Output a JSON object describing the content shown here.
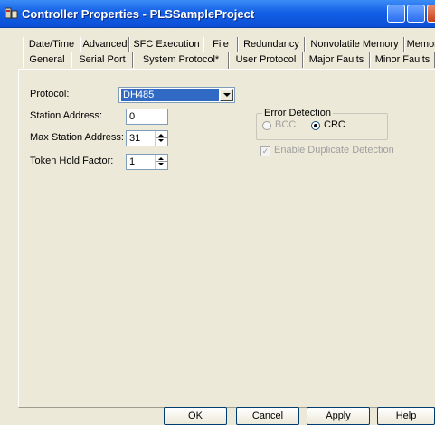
{
  "window": {
    "title": "Controller Properties - PLSSampleProject"
  },
  "tabs_row1": [
    "Date/Time",
    "Advanced",
    "SFC Execution",
    "File",
    "Redundancy",
    "Nonvolatile Memory",
    "Memory"
  ],
  "tabs_row2": [
    "General",
    "Serial Port",
    "System Protocol*",
    "User Protocol",
    "Major Faults",
    "Minor Faults"
  ],
  "selected_tab": "System Protocol*",
  "form": {
    "protocol_label": "Protocol:",
    "protocol_value": "DH485",
    "station_address_label": "Station Address:",
    "station_address_value": "0",
    "max_station_address_label": "Max Station Address:",
    "max_station_address_value": "31",
    "token_hold_factor_label": "Token Hold Factor:",
    "token_hold_factor_value": "1"
  },
  "error_detection": {
    "title": "Error Detection",
    "bcc_label": "BCC",
    "crc_label": "CRC",
    "selected": "CRC"
  },
  "enable_duplicate_detection": {
    "label": "Enable Duplicate Detection",
    "checked": true,
    "enabled": false
  },
  "buttons": {
    "ok": "OK",
    "cancel": "Cancel",
    "apply": "Apply",
    "help": "Help"
  }
}
